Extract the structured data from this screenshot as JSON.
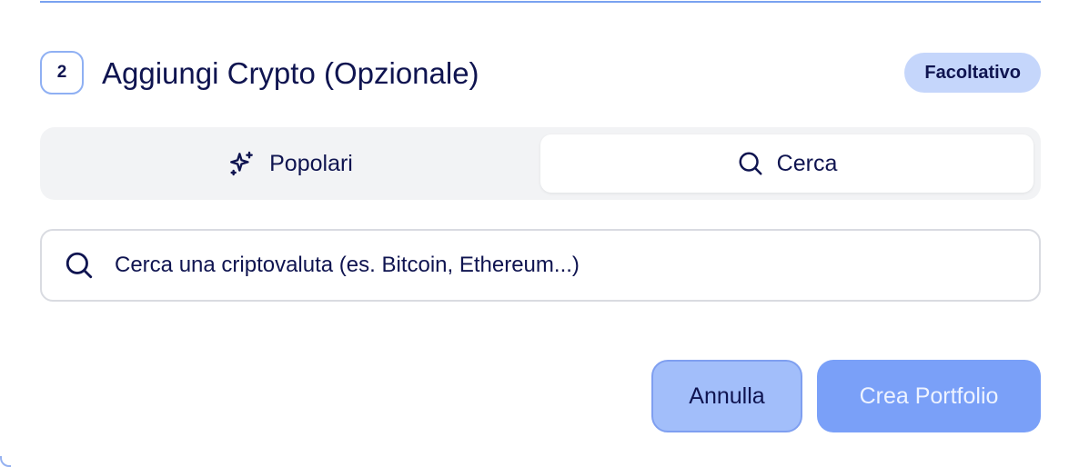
{
  "step": {
    "number": "2",
    "title": "Aggiungi Crypto (Opzionale)",
    "badge": "Facoltativo"
  },
  "tabs": [
    {
      "label": "Popolari",
      "icon": "sparkles-icon",
      "active": false
    },
    {
      "label": "Cerca",
      "icon": "search-icon",
      "active": true
    }
  ],
  "search": {
    "placeholder": "Cerca una criptovaluta (es. Bitcoin, Ethereum...)",
    "value": ""
  },
  "actions": {
    "cancel_label": "Annulla",
    "create_label": "Crea Portfolio"
  },
  "colors": {
    "text": "#0f1450",
    "accent": "#7aa0f8",
    "badge_bg": "#c5d6fb",
    "tabs_bg": "#f2f3f5"
  }
}
